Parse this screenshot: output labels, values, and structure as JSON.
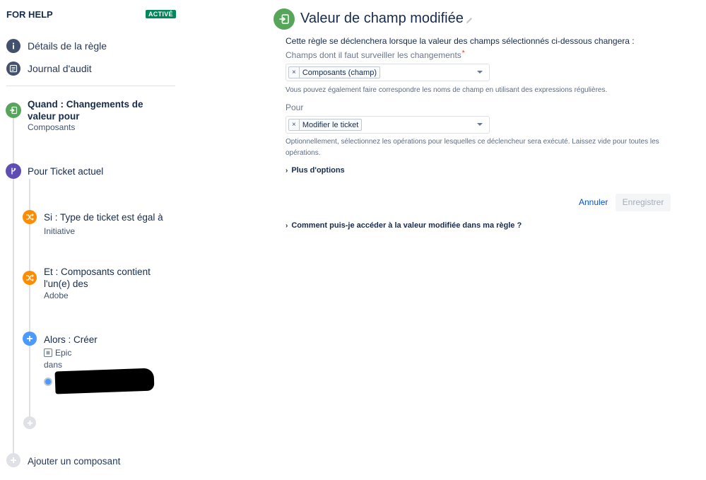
{
  "rule": {
    "name": "FOR HELP",
    "status": "ACTIVÉ"
  },
  "nav": [
    {
      "label": "Détails de la règle",
      "icon": "info-icon"
    },
    {
      "label": "Journal d'audit",
      "icon": "audit-log-icon"
    }
  ],
  "steps": {
    "trigger": {
      "title": "Quand : Changements de valeur pour",
      "subtitle": "Composants",
      "icon": "field-changed-icon",
      "color": "#57a55a"
    },
    "branch": {
      "title": "Pour Ticket actuel",
      "icon": "branch-icon",
      "color": "#5e4db2"
    },
    "condition1": {
      "title": "Si : Type de ticket est égal à",
      "subtitle": "Initiative",
      "icon": "shuffle-icon",
      "color": "#ff8b00"
    },
    "condition2": {
      "title": "Et : Composants contient l'un(e) des",
      "subtitle": "Adobe",
      "icon": "shuffle-icon",
      "color": "#ff8b00"
    },
    "action": {
      "title": "Alors : Créer",
      "issue_type": "Epic",
      "in_label": "dans",
      "icon": "plus-icon",
      "color": "#4c9aff"
    },
    "add_branch_step": {
      "icon": "plus-icon"
    },
    "add_component": {
      "label": "Ajouter un composant",
      "icon": "plus-icon"
    }
  },
  "panel": {
    "title": "Valeur de champ modifiée",
    "description": "Cette règle se déclenchera lorsque la valeur des champs sélectionnés ci-dessous changera :",
    "fields": {
      "label": "Champs dont il faut surveiller les changements",
      "required_mark": "*",
      "chip": "Composants (champ)",
      "help": "Vous pouvez également faire correspondre les noms de champ en utilisant des expressions régulières."
    },
    "operations": {
      "label": "Pour",
      "chip": "Modifier le ticket",
      "help": "Optionnellement, sélectionnez les opérations pour lesquelles ce déclencheur sera exécuté. Laissez vide pour toutes les opérations."
    },
    "more_options": "Plus d'options",
    "cancel": "Annuler",
    "save": "Enregistrer",
    "faq": "Comment puis-je accéder à la valeur modifiée dans ma règle ?"
  },
  "colors": {
    "active": "#00875a",
    "link": "#0052cc",
    "trigger": "#57a55a"
  }
}
